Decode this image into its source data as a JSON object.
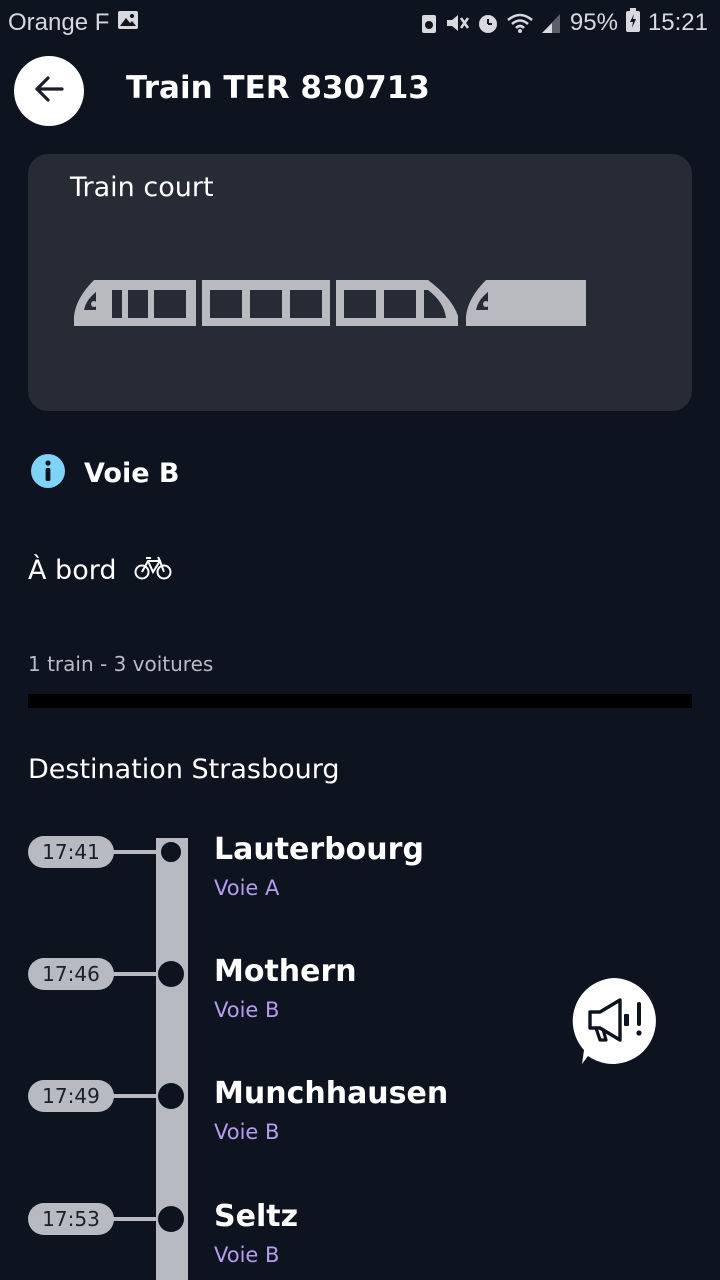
{
  "status_bar": {
    "carrier": "Orange F",
    "battery": "95%",
    "time": "15:21",
    "icons": [
      "image-icon",
      "alarm-lock-icon",
      "mute-vibrate-icon",
      "alarm-clock-icon",
      "wifi-icon",
      "signal-icon",
      "battery-charging-icon"
    ]
  },
  "header": {
    "back_icon": "arrow-left-icon",
    "title": "Train TER 830713"
  },
  "train_card": {
    "label": "Train court"
  },
  "platform_info": {
    "icon": "info-icon",
    "label": "Voie B",
    "icon_color": "#7fd3f7"
  },
  "onboard": {
    "label": "À bord",
    "icon": "bicycle-icon"
  },
  "composition": {
    "text": "1 train - 3 voitures"
  },
  "route": {
    "title": "Destination Strasbourg",
    "stops": [
      {
        "time": "17:41",
        "name": "Lauterbourg",
        "platform": "Voie A"
      },
      {
        "time": "17:46",
        "name": "Mothern",
        "platform": "Voie B"
      },
      {
        "time": "17:49",
        "name": "Munchhausen",
        "platform": "Voie B"
      },
      {
        "time": "17:53",
        "name": "Seltz",
        "platform": "Voie B"
      }
    ]
  },
  "report_button": {
    "icon": "megaphone-icon"
  },
  "colors": {
    "background": "#0e1320",
    "card": "#262b36",
    "platform_text": "#b69cf0",
    "timeline": "#b7bac0"
  }
}
